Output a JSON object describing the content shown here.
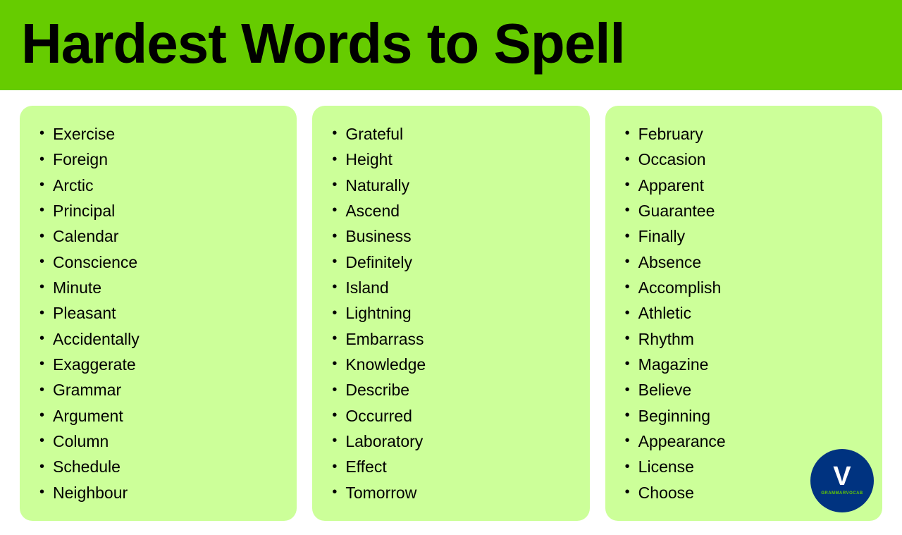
{
  "header": {
    "title": "Hardest Words to Spell"
  },
  "columns": [
    {
      "id": "col1",
      "words": [
        "Exercise",
        "Foreign",
        "Arctic",
        "Principal",
        "Calendar",
        "Conscience",
        "Minute",
        "Pleasant",
        "Accidentally",
        "Exaggerate",
        "Grammar",
        "Argument",
        "Column",
        "Schedule",
        "Neighbour"
      ]
    },
    {
      "id": "col2",
      "words": [
        "Grateful",
        "Height",
        "Naturally",
        "Ascend",
        "Business",
        "Definitely",
        "Island",
        "Lightning",
        "Embarrass",
        "Knowledge",
        "Describe",
        "Occurred",
        "Laboratory",
        "Effect",
        "Tomorrow"
      ]
    },
    {
      "id": "col3",
      "words": [
        "February",
        "Occasion",
        "Apparent",
        "Guarantee",
        "Finally",
        "Absence",
        "Accomplish",
        "Athletic",
        "Rhythm",
        "Magazine",
        "Believe",
        "Beginning",
        "Appearance",
        "License",
        "Choose"
      ]
    }
  ],
  "logo": {
    "letter": "V",
    "text": "GRAMMARVOCAB"
  }
}
